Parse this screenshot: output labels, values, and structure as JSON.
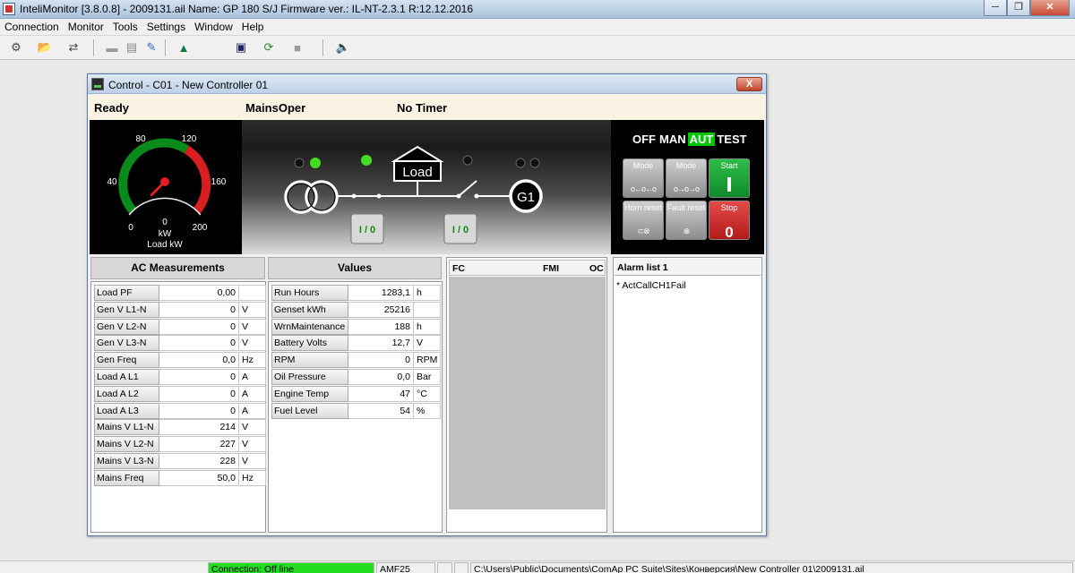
{
  "app": {
    "title": "InteliMonitor [3.8.0.8] - 2009131.ail Name: GP 180 S/J Firmware ver.: IL-NT-2.3.1 R:12.12.2016",
    "window_buttons": [
      "minimize-icon",
      "restore-icon",
      "close-icon"
    ]
  },
  "menu": [
    "Connection",
    "Monitor",
    "Tools",
    "Settings",
    "Window",
    "Help"
  ],
  "toolbar_icons": [
    "connect-icon",
    "open-archive-icon",
    "disconnect-icon",
    "card-icon",
    "list-icon",
    "edit-icon",
    "chart-icon",
    "monitor-icon",
    "refresh-icon",
    "print-icon",
    "speaker-icon"
  ],
  "window": {
    "title": "Control - C01 - New Controller 01",
    "close_label": "X"
  },
  "status": {
    "state": "Ready",
    "mode": "MainsOper",
    "timer": "No Timer"
  },
  "gauge": {
    "ticks": [
      "0",
      "40",
      "80",
      "120",
      "160",
      "200"
    ],
    "reading": "0",
    "unit": "kW",
    "label": "Load kW",
    "value": 0,
    "max": 200
  },
  "mimic": {
    "load_label": "Load",
    "gen_label": "G1",
    "mcb_button": "I / 0",
    "gcb_button": "I / 0"
  },
  "control": {
    "modes": [
      "OFF",
      "MAN",
      "AUT",
      "TEST"
    ],
    "active_mode": "AUT",
    "buttons": [
      {
        "label": "Mode",
        "symbol": "o←o←o"
      },
      {
        "label": "Mode",
        "symbol": "o→o→o"
      },
      {
        "label": "Start",
        "symbol": "I"
      },
      {
        "label": "Horn reset",
        "symbol": "⊂⊗"
      },
      {
        "label": "Fault reset",
        "symbol": "⊗"
      },
      {
        "label": "Stop",
        "symbol": "0"
      }
    ]
  },
  "ac": {
    "header": "AC Measurements",
    "rows": [
      {
        "name": "Load PF",
        "value": "0,00",
        "unit": ""
      },
      {
        "name": "Gen V L1-N",
        "value": "0",
        "unit": "V"
      },
      {
        "name": "Gen V L2-N",
        "value": "0",
        "unit": "V"
      },
      {
        "name": "Gen V L3-N",
        "value": "0",
        "unit": "V"
      },
      {
        "name": "Gen Freq",
        "value": "0,0",
        "unit": "Hz"
      },
      {
        "name": "Load A L1",
        "value": "0",
        "unit": "A"
      },
      {
        "name": "Load A L2",
        "value": "0",
        "unit": "A"
      },
      {
        "name": "Load A L3",
        "value": "0",
        "unit": "A"
      },
      {
        "name": "Mains V L1-N",
        "value": "214",
        "unit": "V"
      },
      {
        "name": "Mains V L2-N",
        "value": "227",
        "unit": "V"
      },
      {
        "name": "Mains V L3-N",
        "value": "228",
        "unit": "V"
      },
      {
        "name": "Mains Freq",
        "value": "50,0",
        "unit": "Hz"
      }
    ]
  },
  "values": {
    "header": "Values",
    "rows": [
      {
        "name": "Run Hours",
        "value": "1283,1",
        "unit": "h"
      },
      {
        "name": "Genset kWh",
        "value": "25216",
        "unit": ""
      },
      {
        "name": "WrnMaintenance",
        "value": "188",
        "unit": "h"
      },
      {
        "name": "Battery Volts",
        "value": "12,7",
        "unit": "V"
      },
      {
        "name": "RPM",
        "value": "0",
        "unit": "RPM"
      },
      {
        "name": "Oil Pressure",
        "value": "0,0",
        "unit": "Bar"
      },
      {
        "name": "Engine Temp",
        "value": "47",
        "unit": "°C"
      },
      {
        "name": "Fuel Level",
        "value": "54",
        "unit": "%"
      }
    ]
  },
  "fault_table": {
    "columns": [
      "FC",
      "FMI",
      "OC"
    ]
  },
  "alarms": {
    "header": "Alarm list 1",
    "items": [
      "* ActCallCH1Fail"
    ]
  },
  "statusbar": {
    "connection": "Connection: Off line",
    "controller": "AMF25",
    "path": "C:\\Users\\Public\\Documents\\ComAp PC Suite\\Sites\\Конверсия\\New Controller 01\\2009131.ail"
  },
  "colors": {
    "active_mode": "#00c800",
    "connection_offline": "#22dd22",
    "start": "#1aa43a",
    "stop": "#cc2222"
  }
}
